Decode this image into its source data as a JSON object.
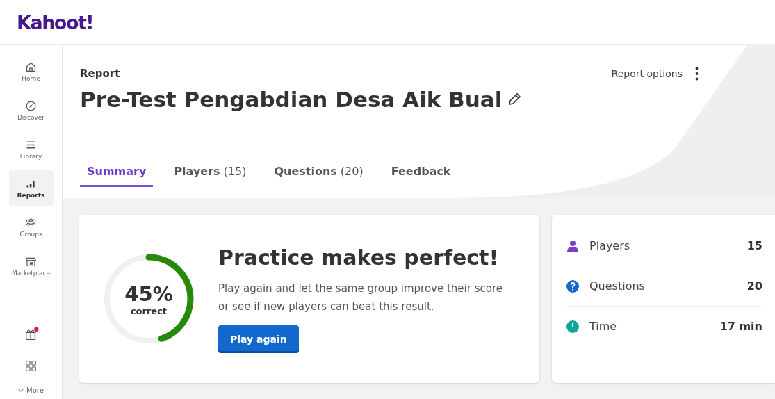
{
  "logo": "Kahoot!",
  "sidebar": {
    "items": [
      {
        "kind": "home",
        "label": "Home",
        "selected": false
      },
      {
        "kind": "discover",
        "label": "Discover",
        "selected": false
      },
      {
        "kind": "library",
        "label": "Library",
        "selected": false
      },
      {
        "kind": "reports",
        "label": "Reports",
        "selected": true
      },
      {
        "kind": "groups",
        "label": "Groups",
        "selected": false
      },
      {
        "kind": "marketplace",
        "label": "Marketplace",
        "selected": false
      }
    ],
    "bottom": [
      {
        "kind": "gift",
        "notification": true
      },
      {
        "kind": "apps",
        "notification": false
      }
    ],
    "more": "More"
  },
  "header": {
    "eyebrow": "Report",
    "title": "Pre-Test Pengabdian Desa Aik Bual",
    "options": "Report options"
  },
  "tabs": [
    {
      "label": "Summary",
      "selected": true
    },
    {
      "label": "Players",
      "count": "(15)",
      "selected": false
    },
    {
      "label": "Questions",
      "count": "(20)",
      "selected": false
    },
    {
      "label": "Feedback",
      "selected": false
    }
  ],
  "summary": {
    "level": 0.45,
    "percent": "45%",
    "caption": "correct",
    "heading": "Practice makes perfect!",
    "text": "Play again and let the same group improve their score or see if new players can beat this result.",
    "button": "Play again"
  },
  "stats": [
    {
      "kind": "players",
      "label": "Players",
      "value": "15",
      "color": "#7b3fc4"
    },
    {
      "kind": "questions",
      "label": "Questions",
      "value": "20",
      "color": "#1368ce"
    },
    {
      "kind": "time",
      "label": "Time",
      "value": "17 min",
      "color": "#12a39a"
    }
  ]
}
